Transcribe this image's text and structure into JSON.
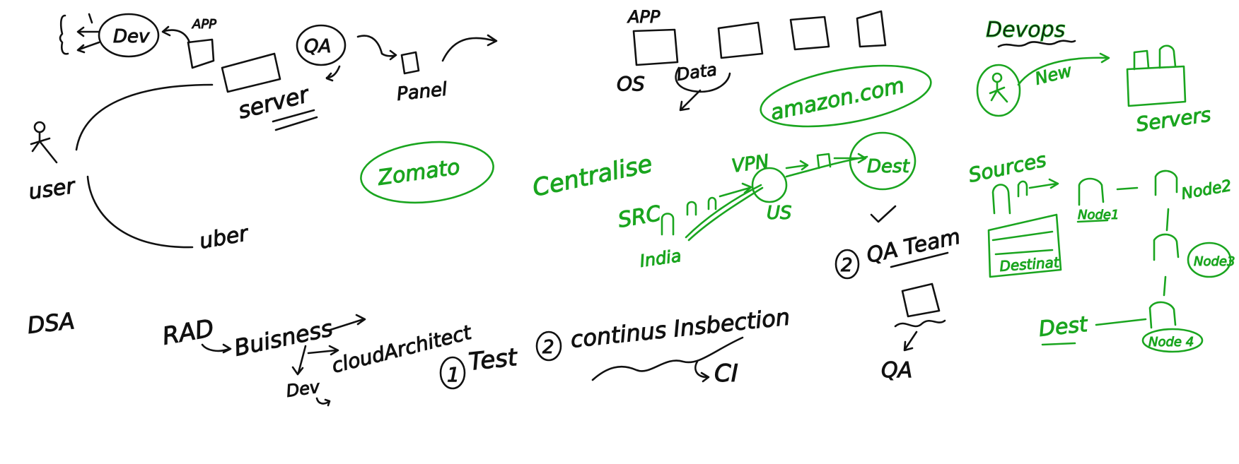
{
  "colors": {
    "ink_black": "#111111",
    "ink_green": "#1aa51f",
    "background": "#ffffff"
  },
  "labels": {
    "dev": "Dev",
    "app_top_left": "APP",
    "server": "server",
    "qa": "QA",
    "panel": "Panel",
    "user": "user",
    "uber": "uber",
    "zomato": "Zomato",
    "dsa": "DSA",
    "rad": "RAD",
    "business": "Buisness",
    "cloud_architect": "cloudArchitect",
    "dev_bottom": "Dev",
    "test": "Test",
    "one": "1",
    "two_ci": "2",
    "continuous_inspection": "continus Insbection",
    "ci": "CI",
    "app_top_center": "APP",
    "os": "OS",
    "data": "Data",
    "amazon": "amazon.com",
    "centralize": "Centralise",
    "vpn": "VPN",
    "us": "US",
    "dest": "Dest",
    "src": "SRC",
    "india": "India",
    "two_qa": "2",
    "qa_team": "QA Team",
    "qa_bottom": "QA",
    "devops": "Devops",
    "new": "New",
    "servers": "Servers",
    "sources": "Sources",
    "destinat": "Destinat",
    "node1": "Node1",
    "node2": "Node2",
    "node3": "Node3",
    "node4": "Node 4",
    "dest_bottom": "Dest"
  }
}
